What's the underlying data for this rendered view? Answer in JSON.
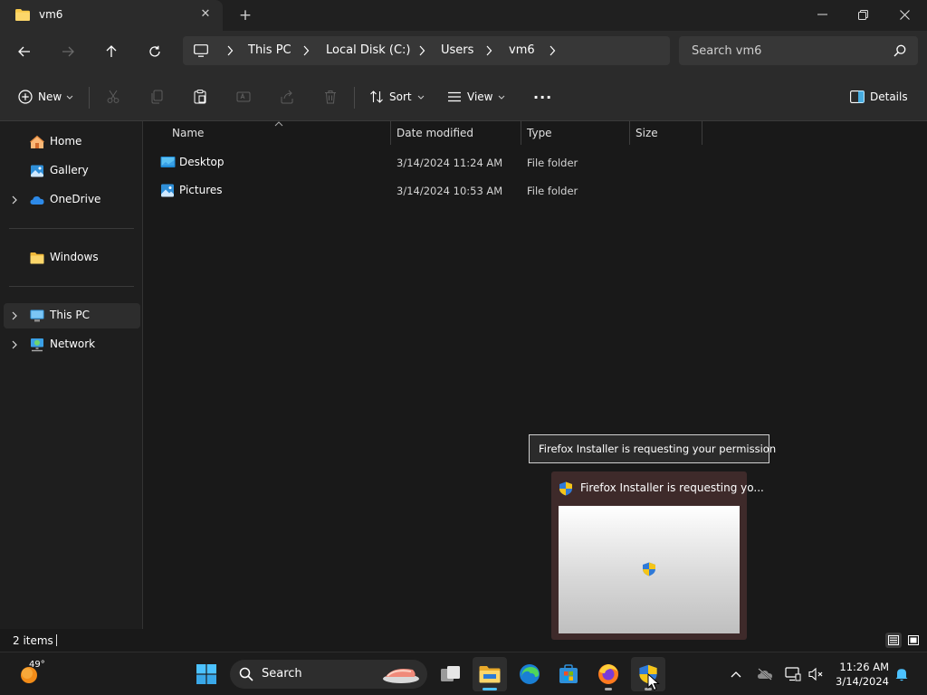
{
  "window": {
    "tab_title": "vm6",
    "tab_close": "✕",
    "new_tab": "+"
  },
  "address": {
    "crumbs": [
      "This PC",
      "Local Disk (C:)",
      "Users",
      "vm6"
    ],
    "search_placeholder": "Search vm6"
  },
  "toolbar": {
    "new_label": "New",
    "sort_label": "Sort",
    "view_label": "View",
    "more_label": "···",
    "details_label": "Details"
  },
  "nav": {
    "items": [
      {
        "label": "Home",
        "icon": "home-icon"
      },
      {
        "label": "Gallery",
        "icon": "gallery-icon"
      },
      {
        "label": "OneDrive",
        "icon": "cloud-icon"
      },
      {
        "label": "Windows",
        "icon": "folder-icon"
      },
      {
        "label": "This PC",
        "icon": "computer-icon"
      },
      {
        "label": "Network",
        "icon": "network-icon"
      }
    ]
  },
  "files": {
    "columns": [
      "Name",
      "Date modified",
      "Type",
      "Size"
    ],
    "rows": [
      {
        "name": "Desktop",
        "date": "3/14/2024 11:24 AM",
        "type": "File folder",
        "size": ""
      },
      {
        "name": "Pictures",
        "date": "3/14/2024 10:53 AM",
        "type": "File folder",
        "size": ""
      }
    ]
  },
  "status": {
    "item_count": "2 items"
  },
  "tooltip": {
    "text": "Firefox Installer is requesting your permission"
  },
  "preview": {
    "title": "Firefox Installer is requesting yo..."
  },
  "taskbar": {
    "weather_temp": "49°",
    "search_label": "Search",
    "time": "11:26 AM",
    "date": "3/14/2024"
  },
  "colors": {
    "accent": "#4cc2ff",
    "folder": "#f8c94a",
    "window_bg": "#191919",
    "chrome_bg": "#2b2b2b"
  }
}
